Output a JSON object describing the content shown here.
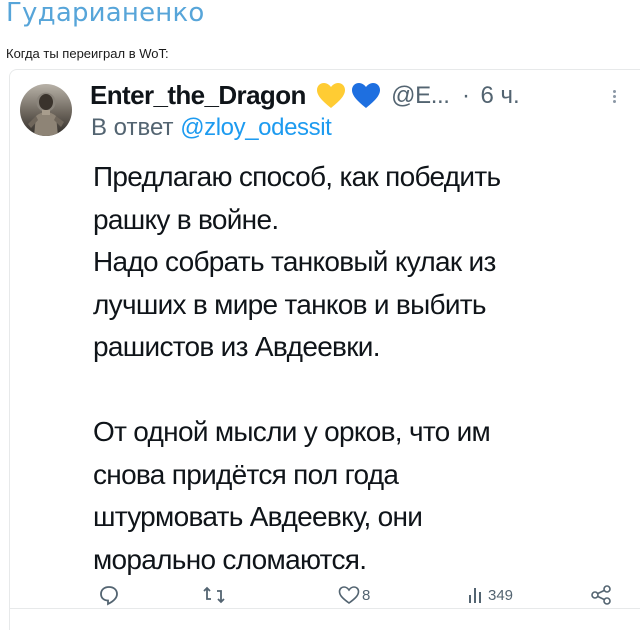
{
  "post": {
    "author": "Гударианенко",
    "caption": "Когда ты переиграл в WoT:"
  },
  "tweet": {
    "display_name": "Enter_the_Dragon",
    "handle": "@E...",
    "dot": "·",
    "time_ago": "6 ч.",
    "reply_prefix": "В ответ",
    "reply_to": "@zloy_odessit",
    "body_lines": [
      "Предлагаю способ, как победить",
      "рашку в войне.",
      "Надо собрать танковый кулак из",
      "лучших в мире танков и выбить",
      "рашистов из Авдеевки.",
      "От одной мысли у орков, что им",
      "снова придётся пол года",
      "штурмовать Авдеевку, они",
      "морально сломаются."
    ],
    "stats": {
      "likes": "8",
      "views": "349"
    },
    "icons": {
      "reply": "reply-icon",
      "retweet": "retweet-icon",
      "like": "heart-icon",
      "views": "views-icon",
      "share": "share-icon",
      "more": "more-icon",
      "emoji": [
        "yellow-heart-icon",
        "blue-heart-icon"
      ]
    },
    "colors": {
      "author_name": "#57a5d9",
      "mention": "#1d9bf0",
      "secondary_text": "#536471",
      "yellow_heart": "#ffcc33",
      "blue_heart": "#1e6fe0"
    }
  }
}
